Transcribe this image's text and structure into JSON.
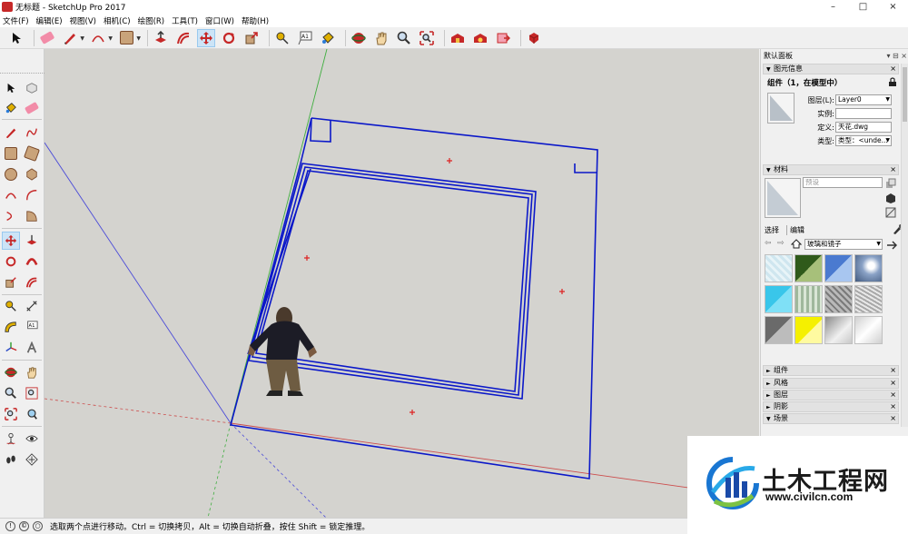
{
  "window": {
    "title": "无标题 - SketchUp Pro 2017",
    "controls": {
      "minimize": "–",
      "maximize": "□",
      "close": "×"
    }
  },
  "menu": [
    "文件(F)",
    "编辑(E)",
    "视图(V)",
    "相机(C)",
    "绘图(R)",
    "工具(T)",
    "窗口(W)",
    "帮助(H)"
  ],
  "toolbar": {
    "tools": [
      "select-tool",
      "eraser-tool",
      "line-tool",
      "arc-tool",
      "rectangle-tool",
      "push-pull-tool",
      "offset-tool",
      "move-tool",
      "rotate-tool",
      "scale-tool",
      "tape-measure-tool",
      "text-tool",
      "paint-bucket-tool",
      "orbit-tool",
      "pan-tool",
      "zoom-tool",
      "zoom-extents-tool",
      "3d-warehouse-tool",
      "extension-warehouse-tool",
      "send-to-layout-tool",
      "extension-manager-tool"
    ],
    "active": "move-tool"
  },
  "left_tools": {
    "active": "move-tool",
    "text_label": "A1"
  },
  "panel": {
    "title": "默认面板",
    "entity_info": {
      "header": "图元信息",
      "selection": "组件（1，在模型中）",
      "layer_label": "图层(L):",
      "layer_value": "Layer0",
      "instance_label": "实例:",
      "instance_value": "",
      "definition_label": "定义:",
      "definition_value": "天花.dwg",
      "type_label": "类型:",
      "type_value": "类型：<unde..."
    },
    "materials": {
      "header": "材料",
      "material_name_placeholder": "预设",
      "tab_select": "选择",
      "tab_edit": "编辑",
      "library": "玻璃和镜子",
      "swatch_colors": [
        "#cfe6ef",
        "#4d7a2e",
        "#7aa7de",
        "#8aa2c6",
        "#39c6ea",
        "#9fb89c",
        "#8c8c8c",
        "#c8c8c8",
        "#8a8a8a",
        "#f5f000",
        "#b4b4b4",
        "#ececec"
      ]
    },
    "collapsed_sections": [
      "组件",
      "风格",
      "图层",
      "阴影",
      "场景"
    ]
  },
  "status": {
    "text": "选取两个点进行移动。Ctrl = 切换拷贝，Alt = 切换自动折叠，按住 Shift = 锁定推理。"
  },
  "watermark": {
    "name": "土木工程网",
    "url": "www.civilcn.com"
  },
  "colors": {
    "model_lines": "#0b18c9",
    "viewport_bg": "#d4d3cf",
    "axis_red": "#cc4444",
    "axis_green": "#44aa44",
    "axis_blue": "#4444cc",
    "active_tool": "#cce4f7"
  }
}
